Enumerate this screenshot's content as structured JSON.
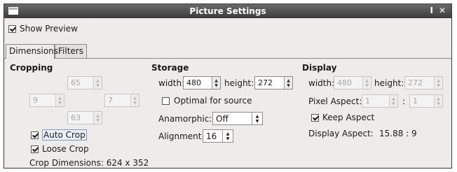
{
  "window": {
    "title": "Picture Settings",
    "min_icon": "I",
    "close_icon": "✕"
  },
  "show_preview": {
    "label": "Show Preview",
    "checked": true
  },
  "tabs": [
    {
      "label": "Dimensions",
      "active": true
    },
    {
      "label": "Filters",
      "active": false
    }
  ],
  "cropping": {
    "header": "Cropping",
    "top": "65",
    "left": "9",
    "right": "7",
    "bottom": "63",
    "auto_crop": {
      "label": "Auto Crop",
      "checked": true
    },
    "loose_crop": {
      "label": "Loose Crop",
      "checked": true
    },
    "dimensions_text": "Crop Dimensions: 624 x 352"
  },
  "storage": {
    "header": "Storage",
    "width_label": "width:",
    "width_value": "480",
    "height_label": "height:",
    "height_value": "272",
    "optimal": {
      "label": "Optimal for source",
      "checked": false
    },
    "anamorphic_label": "Anamorphic:",
    "anamorphic_value": "Off",
    "alignment_label": "Alignment:",
    "alignment_value": "16"
  },
  "display": {
    "header": "Display",
    "width_label": "width:",
    "width_value": "480",
    "height_label": "height:",
    "height_value": "272",
    "pixel_aspect_label": "Pixel Aspect:",
    "pixel_aspect_num": "1",
    "pixel_aspect_sep": ":",
    "pixel_aspect_den": "1",
    "keep_aspect": {
      "label": "Keep Aspect",
      "checked": true
    },
    "display_aspect_label": "Display Aspect:",
    "display_aspect_value": "15.88 : 9"
  }
}
